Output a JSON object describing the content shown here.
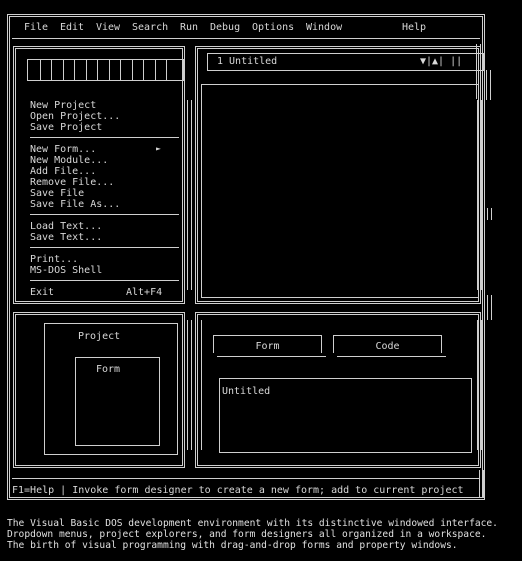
{
  "menubar": {
    "items": [
      "File",
      "Edit",
      "View",
      "Search",
      "Run",
      "Debug",
      "Options",
      "Window"
    ],
    "help": "Help"
  },
  "file_menu": {
    "groups": [
      [
        "New Project",
        "Open Project...",
        "Save Project"
      ],
      [
        "New Form...",
        "New Module...",
        "Add File...",
        "Remove File...",
        "Save File",
        "Save File As..."
      ],
      [
        "Load Text...",
        "Save Text..."
      ],
      [
        "Print...",
        "MS-DOS Shell"
      ]
    ],
    "submenu_arrow": "►",
    "exit_label": "Exit",
    "exit_shortcut": "Alt+F4"
  },
  "editor_window": {
    "title": "1 Untitled",
    "controls": "▼|▲| ||"
  },
  "project_window": {
    "title": "Project",
    "item": "Form"
  },
  "form_window": {
    "form_button": "Form",
    "code_button": "Code",
    "file_list": [
      "Untitled"
    ]
  },
  "status_bar": {
    "text": "F1=Help | Invoke form designer to create a new form; add to current project"
  },
  "caption": [
    "The Visual Basic DOS development environment with its distinctive windowed interface.",
    "Dropdown menus, project explorers, and form designers all organized in a workspace.",
    "The birth of visual programming with drag-and-drop forms and property windows."
  ]
}
